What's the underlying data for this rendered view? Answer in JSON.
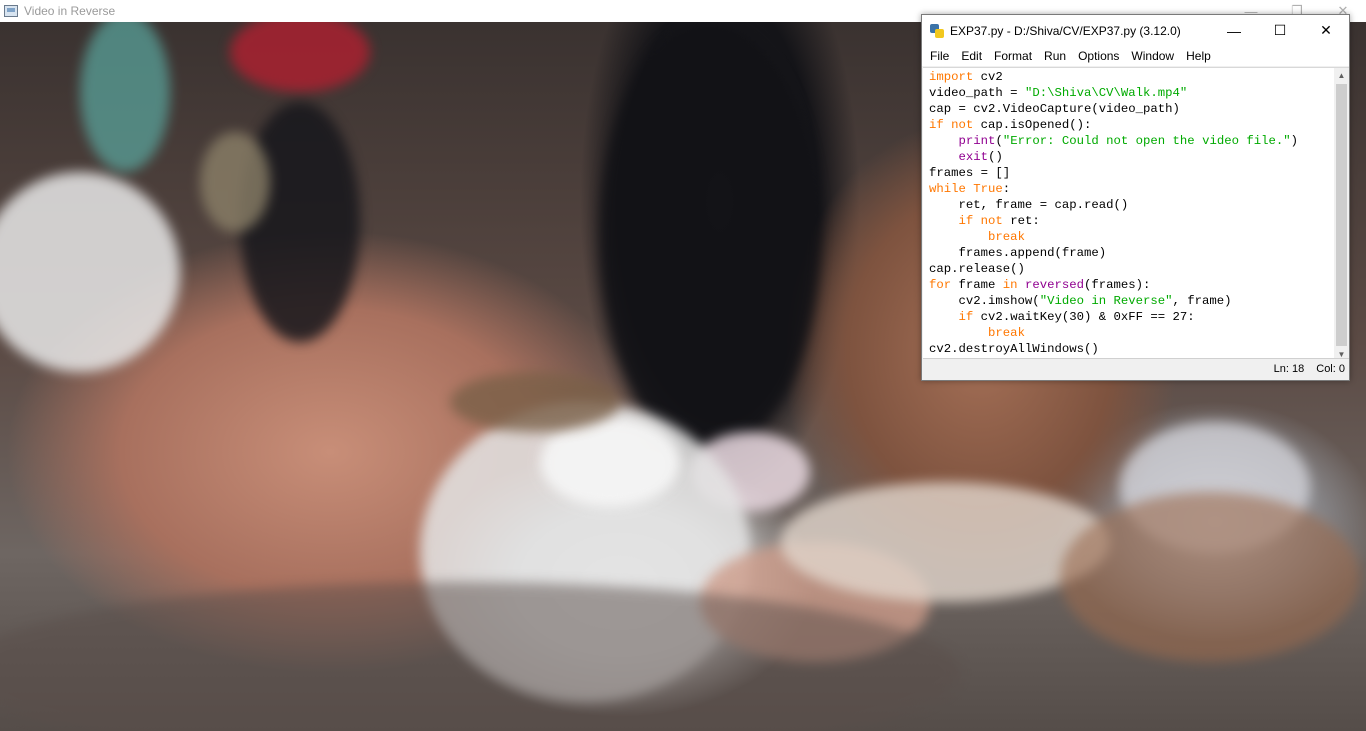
{
  "cv_window": {
    "title": "Video in Reverse",
    "controls": {
      "minimize": "—",
      "maximize": "❐",
      "close": "✕"
    }
  },
  "idle_window": {
    "title": "EXP37.py - D:/Shiva/CV/EXP37.py (3.12.0)",
    "controls": {
      "minimize": "—",
      "maximize": "☐",
      "close": "✕"
    },
    "menu": [
      "File",
      "Edit",
      "Format",
      "Run",
      "Options",
      "Window",
      "Help"
    ],
    "code_lines": [
      [
        [
          "kw",
          "import"
        ],
        [
          "t",
          " cv2"
        ]
      ],
      [
        [
          "t",
          "video_path = "
        ],
        [
          "st",
          "\"D:\\Shiva\\CV\\Walk.mp4\""
        ]
      ],
      [
        [
          "t",
          "cap = cv2.VideoCapture(video_path)"
        ]
      ],
      [
        [
          "kw",
          "if not"
        ],
        [
          "t",
          " cap.isOpened():"
        ]
      ],
      [
        [
          "t",
          "    "
        ],
        [
          "bi",
          "print"
        ],
        [
          "t",
          "("
        ],
        [
          "st",
          "\"Error: Could not open the video file.\""
        ],
        [
          "t",
          ")"
        ]
      ],
      [
        [
          "t",
          "    "
        ],
        [
          "bi",
          "exit"
        ],
        [
          "t",
          "()"
        ]
      ],
      [
        [
          "t",
          "frames = []"
        ]
      ],
      [
        [
          "kw",
          "while True"
        ],
        [
          "t",
          ":"
        ]
      ],
      [
        [
          "t",
          "    ret, frame = cap.read()"
        ]
      ],
      [
        [
          "t",
          "    "
        ],
        [
          "kw",
          "if not"
        ],
        [
          "t",
          " ret:"
        ]
      ],
      [
        [
          "t",
          "        "
        ],
        [
          "kw",
          "break"
        ]
      ],
      [
        [
          "t",
          "    frames.append(frame)"
        ]
      ],
      [
        [
          "t",
          "cap.release()"
        ]
      ],
      [
        [
          "kw",
          "for"
        ],
        [
          "t",
          " frame "
        ],
        [
          "kw",
          "in"
        ],
        [
          "t",
          " "
        ],
        [
          "bi",
          "reversed"
        ],
        [
          "t",
          "(frames):"
        ]
      ],
      [
        [
          "t",
          "    cv2.imshow("
        ],
        [
          "st",
          "\"Video in Reverse\""
        ],
        [
          "t",
          ", frame)"
        ]
      ],
      [
        [
          "t",
          "    "
        ],
        [
          "kw",
          "if"
        ],
        [
          "t",
          " cv2.waitKey(30) & 0xFF == 27:"
        ]
      ],
      [
        [
          "t",
          "        "
        ],
        [
          "kw",
          "break"
        ]
      ],
      [
        [
          "t",
          "cv2.destroyAllWindows()"
        ]
      ]
    ],
    "status": {
      "line": "Ln: 18",
      "col": "Col: 0"
    },
    "scroll": {
      "up": "▲",
      "down": "▼"
    }
  }
}
